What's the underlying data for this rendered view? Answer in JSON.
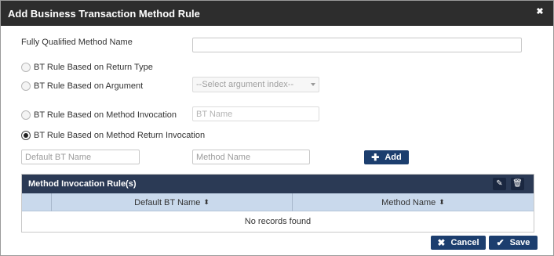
{
  "dialog": {
    "title": "Add Business Transaction Method Rule",
    "close_glyph": "✖"
  },
  "form": {
    "fqmn_label": "Fully Qualified Method Name",
    "fqmn_value": "",
    "options": {
      "return_type": "BT Rule Based on Return Type",
      "argument": "BT Rule Based on Argument",
      "method_invocation": "BT Rule Based on Method Invocation",
      "method_return_invocation": "BT Rule Based on Method Return Invocation"
    },
    "selected_option": "method_return_invocation",
    "argument_select_placeholder": "--Select argument index--",
    "bt_name_placeholder": "BT Name",
    "default_bt_name_placeholder": "Default BT Name",
    "method_name_placeholder": "Method Name",
    "add_label": "Add"
  },
  "grid": {
    "title": "Method Invocation Rule(s)",
    "columns": [
      "Default BT Name",
      "Method Name"
    ],
    "sort_glyph": "▲▼",
    "empty_text": "No records found"
  },
  "footer": {
    "cancel_label": "Cancel",
    "save_label": "Save"
  },
  "icons": {
    "close": "close-icon",
    "plus": "plus-icon",
    "pencil": "pencil-icon",
    "trash": "trash-icon",
    "times": "times-icon",
    "check": "check-icon"
  },
  "colors": {
    "titlebar": "#2d2d2d",
    "button": "#1c3e6e",
    "grid_header": "#2b3a55",
    "column_header": "#c9d9ec"
  }
}
